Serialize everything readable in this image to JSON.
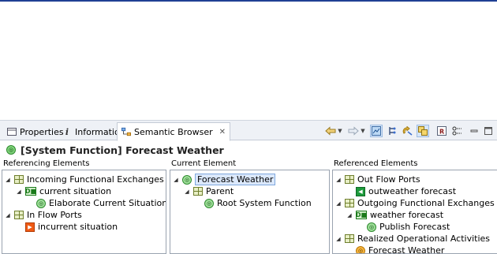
{
  "tabs": [
    {
      "label": "Properties",
      "icon": "properties-icon"
    },
    {
      "label": "Information",
      "icon": "information-icon"
    },
    {
      "label": "Semantic Browser",
      "icon": "semantic-browser-icon",
      "close": "✕"
    }
  ],
  "title": "[System Function] Forecast Weather",
  "columns": {
    "referencing": "Referencing Elements",
    "current": "Current Element",
    "referenced": "Referenced Elements"
  },
  "referencing_tree": [
    {
      "label": "Incoming Functional Exchanges",
      "icon": "grid-category-icon"
    },
    {
      "label": "current situation",
      "icon": "functional-exchange-icon"
    },
    {
      "label": "Elaborate Current Situation",
      "icon": "system-function-icon"
    },
    {
      "label": "In Flow Ports",
      "icon": "grid-category-icon"
    },
    {
      "label": "incurrent situation",
      "icon": "input-port-icon"
    }
  ],
  "current_tree": [
    {
      "label": "Forecast Weather",
      "icon": "system-function-icon"
    },
    {
      "label": "Parent",
      "icon": "grid-category-icon"
    },
    {
      "label": "Root System Function",
      "icon": "system-function-icon"
    }
  ],
  "referenced_tree": [
    {
      "label": "Out Flow Ports",
      "icon": "grid-category-icon"
    },
    {
      "label": "outweather forecast",
      "icon": "output-port-icon"
    },
    {
      "label": "Outgoing Functional Exchanges",
      "icon": "grid-category-icon"
    },
    {
      "label": "weather forecast",
      "icon": "functional-exchange-icon"
    },
    {
      "label": "Publish Forecast",
      "icon": "system-function-icon"
    },
    {
      "label": "Realized Operational Activities",
      "icon": "grid-category-icon"
    },
    {
      "label": "Forecast Weather",
      "icon": "operational-activity-icon"
    }
  ],
  "colors": {
    "accent_rule": "#1f3f94",
    "selection": "#dbe8fb",
    "tabbar": "#eef1f6"
  }
}
